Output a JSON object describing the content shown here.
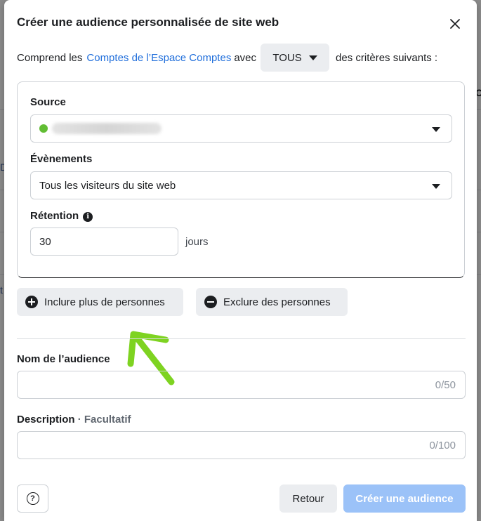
{
  "background": {
    "fragments": [
      "D",
      "Ct",
      "t"
    ]
  },
  "dialog": {
    "title": "Créer une audience personnalisée de site web",
    "intro": {
      "prefix": "Comprend les",
      "link": "Comptes de l’Espace Comptes",
      "middle": "avec",
      "match_mode": "TOUS",
      "suffix": "des critères suivants :"
    },
    "rule": {
      "source_label": "Source",
      "events_label": "Évènements",
      "events_value": "Tous les visiteurs du site web",
      "retention_label": "Rétention",
      "retention_value": "30",
      "retention_unit": "jours"
    },
    "include_button": "Inclure plus de personnes",
    "exclude_button": "Exclure des personnes",
    "name_field": {
      "label": "Nom de l’audience",
      "value": "",
      "counter": "0/50"
    },
    "description_field": {
      "label": "Description",
      "optional": "Facultatif",
      "value": "",
      "counter": "0/100"
    },
    "back_button": "Retour",
    "create_button": "Créer une audience"
  },
  "colors": {
    "link": "#216fdb",
    "primary_disabled": "#9bc2f8",
    "source_status": "#61bd33",
    "annotation_arrow": "#7ed321"
  },
  "icons": {
    "close": "close-icon",
    "dropdown": "caret-down-icon",
    "info": "info-icon",
    "include": "plus-circle-icon",
    "exclude": "minus-circle-icon",
    "help": "question-circle-icon",
    "annotation": "arrow-annotation"
  }
}
